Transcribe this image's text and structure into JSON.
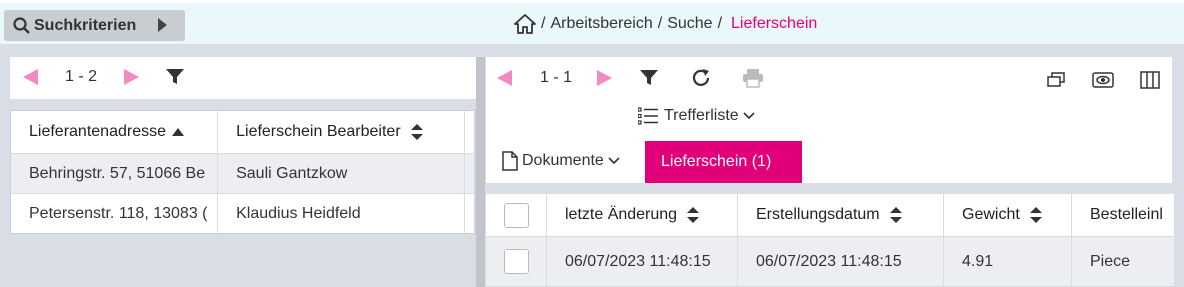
{
  "topbar": {
    "search_label": "Suchkriterien",
    "breadcrumb": [
      "Arbeitsbereich",
      "Suche"
    ],
    "breadcrumb_sep": "/",
    "breadcrumb_current": "Lieferschein"
  },
  "left": {
    "pager_text": "1 - 2",
    "columns": [
      "Lieferantenadresse",
      "Lieferschein Bearbeiter"
    ],
    "rows": [
      [
        "Behringstr. 57, 51066 Be",
        "Sauli Gantzkow"
      ],
      [
        "Petersenstr. 118, 13083 (",
        "Klaudius Heidfeld"
      ]
    ]
  },
  "right": {
    "pager_text": "1 - 1",
    "view_label": "Trefferliste",
    "documents_label": "Dokumente",
    "active_tab_label": "Lieferschein (1)",
    "columns": [
      "letzte Änderung",
      "Erstellungsdatum",
      "Gewicht",
      "Bestelleinl"
    ],
    "rows": [
      [
        "06/07/2023 11:48:15",
        "06/07/2023 11:48:15",
        "4.91",
        "Piece"
      ]
    ]
  },
  "colors": {
    "accent": "#e2007a",
    "pager_arrow": "#f08ac0",
    "topbar_bg": "#eaf7fb",
    "page_bg": "#d9dee6"
  }
}
